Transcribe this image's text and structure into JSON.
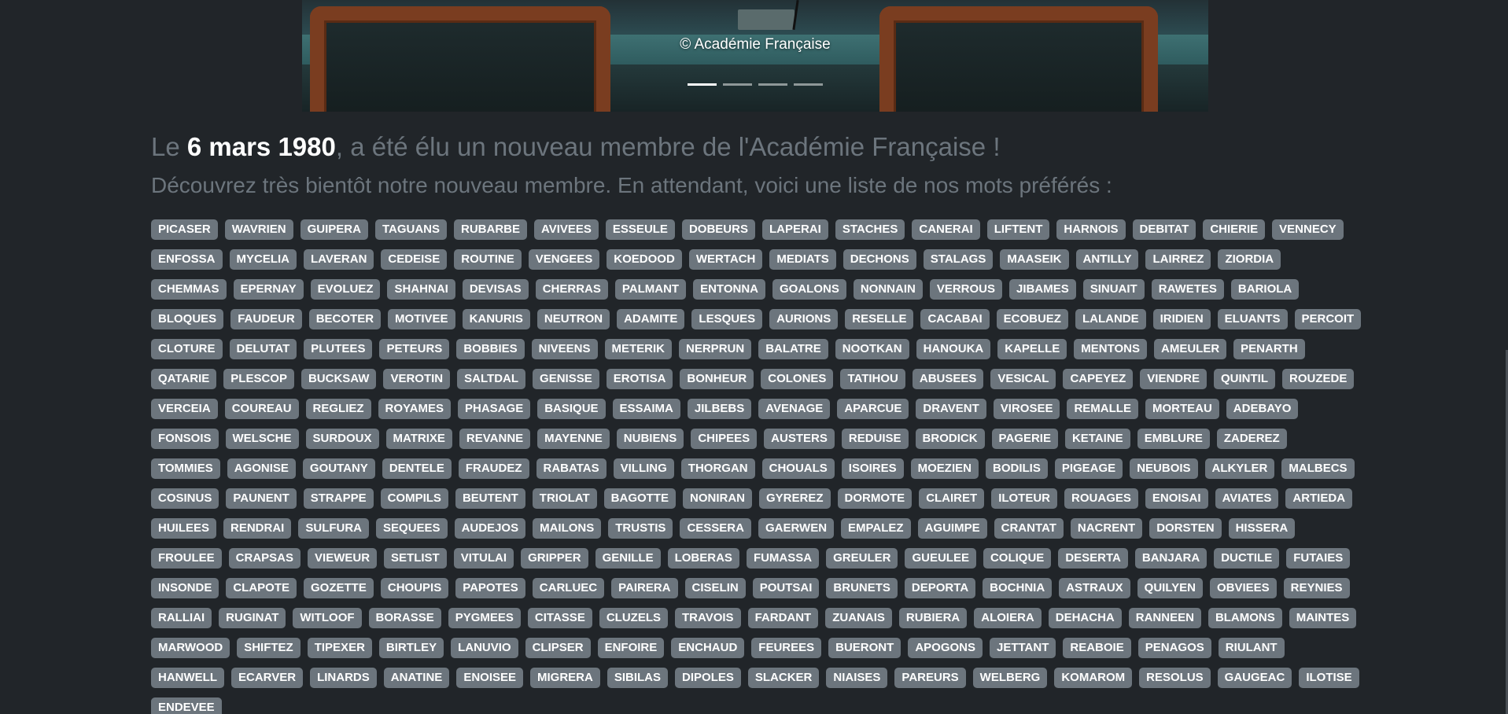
{
  "carousel": {
    "caption": "© Académie Française",
    "slide_count": 4,
    "active_index": 0
  },
  "headline": {
    "prefix": "Le ",
    "date": "6 mars 1980",
    "suffix": ", a été élu un nouveau membre de l'Académie Française !"
  },
  "subline": "Découvrez très bientôt notre nouveau membre. En attendant, voici une liste de nos mots préférés :",
  "badge_color": "#6c757d",
  "words": [
    "PICASER",
    "WAVRIEN",
    "GUIPERA",
    "TAGUANS",
    "RUBARBE",
    "AVIVEES",
    "ESSEULE",
    "DOBEURS",
    "LAPERAI",
    "STACHES",
    "CANERAI",
    "LIFTENT",
    "HARNOIS",
    "DEBITAT",
    "CHIERIE",
    "VENNECY",
    "ENFOSSA",
    "MYCELIA",
    "LAVERAN",
    "CEDEISE",
    "ROUTINE",
    "VENGEES",
    "KOEDOOD",
    "WERTACH",
    "MEDIATS",
    "DECHONS",
    "STALAGS",
    "MAASEIK",
    "ANTILLY",
    "LAIRREZ",
    "ZIORDIA",
    "CHEMMAS",
    "EPERNAY",
    "EVOLUEZ",
    "SHAHNAI",
    "DEVISAS",
    "CHERRAS",
    "PALMANT",
    "ENTONNA",
    "GOALONS",
    "NONNAIN",
    "VERROUS",
    "JIBAMES",
    "SINUAIT",
    "RAWETES",
    "BARIOLA",
    "BLOQUES",
    "FAUDEUR",
    "BECOTER",
    "MOTIVEE",
    "KANURIS",
    "NEUTRON",
    "ADAMITE",
    "LESQUES",
    "AURIONS",
    "RESELLE",
    "CACABAI",
    "ECOBUEZ",
    "LALANDE",
    "IRIDIEN",
    "ELUANTS",
    "PERCOIT",
    "CLOTURE",
    "DELUTAT",
    "PLUTEES",
    "PETEURS",
    "BOBBIES",
    "NIVEENS",
    "METERIK",
    "NERPRUN",
    "BALATRE",
    "NOOTKAN",
    "HANOUKA",
    "KAPELLE",
    "MENTONS",
    "AMEULER",
    "PENARTH",
    "QATARIE",
    "PLESCOP",
    "BUCKSAW",
    "VEROTIN",
    "SALTDAL",
    "GENISSE",
    "EROTISA",
    "BONHEUR",
    "COLONES",
    "TATIHOU",
    "ABUSEES",
    "VESICAL",
    "CAPEYEZ",
    "VIENDRE",
    "QUINTIL",
    "ROUZEDE",
    "VERCEIA",
    "COUREAU",
    "REGLIEZ",
    "ROYAMES",
    "PHASAGE",
    "BASIQUE",
    "ESSAIMA",
    "JILBEBS",
    "AVENAGE",
    "APARCUE",
    "DRAVENT",
    "VIROSEE",
    "REMALLE",
    "MORTEAU",
    "ADEBAYO",
    "FONSOIS",
    "WELSCHE",
    "SURDOUX",
    "MATRIXE",
    "REVANNE",
    "MAYENNE",
    "NUBIENS",
    "CHIPEES",
    "AUSTERS",
    "REDUISE",
    "BRODICK",
    "PAGERIE",
    "KETAINE",
    "EMBLURE",
    "ZADEREZ",
    "TOMMIES",
    "AGONISE",
    "GOUTANY",
    "DENTELE",
    "FRAUDEZ",
    "RABATAS",
    "VILLING",
    "THORGAN",
    "CHOUALS",
    "ISOIRES",
    "MOEZIEN",
    "BODILIS",
    "PIGEAGE",
    "NEUBOIS",
    "ALKYLER",
    "MALBECS",
    "COSINUS",
    "PAUNENT",
    "STRAPPE",
    "COMPILS",
    "BEUTENT",
    "TRIOLAT",
    "BAGOTTE",
    "NONIRAN",
    "GYREREZ",
    "DORMOTE",
    "CLAIRET",
    "ILOTEUR",
    "ROUAGES",
    "ENOISAI",
    "AVIATES",
    "ARTIEDA",
    "HUILEES",
    "RENDRAI",
    "SULFURA",
    "SEQUEES",
    "AUDEJOS",
    "MAILONS",
    "TRUSTIS",
    "CESSERA",
    "GAERWEN",
    "EMPALEZ",
    "AGUIMPE",
    "CRANTAT",
    "NACRENT",
    "DORSTEN",
    "HISSERA",
    "FROULEE",
    "CRAPSAS",
    "VIEWEUR",
    "SETLIST",
    "VITULAI",
    "GRIPPER",
    "GENILLE",
    "LOBERAS",
    "FUMASSA",
    "GREULER",
    "GUEULEE",
    "COLIQUE",
    "DESERTA",
    "BANJARA",
    "DUCTILE",
    "FUTAIES",
    "INSONDE",
    "CLAPOTE",
    "GOZETTE",
    "CHOUPIS",
    "PAPOTES",
    "CARLUEC",
    "PAIRERA",
    "CISELIN",
    "POUTSAI",
    "BRUNETS",
    "DEPORTA",
    "BOCHNIA",
    "ASTRAUX",
    "QUILYEN",
    "OBVIEES",
    "REYNIES",
    "RALLIAI",
    "RUGINAT",
    "WITLOOF",
    "BORASSE",
    "PYGMEES",
    "CITASSE",
    "CLUZELS",
    "TRAVOIS",
    "FARDANT",
    "ZUANAIS",
    "RUBIERA",
    "ALOIERA",
    "DEHACHA",
    "RANNEEN",
    "BLAMONS",
    "MAINTES",
    "MARWOOD",
    "SHIFTEZ",
    "TIPEXER",
    "BIRTLEY",
    "LANUVIO",
    "CLIPSER",
    "ENFOIRE",
    "ENCHAUD",
    "FEUREES",
    "BUERONT",
    "APOGONS",
    "JETTANT",
    "REABOIE",
    "PENAGOS",
    "RIULANT",
    "HANWELL",
    "ECARVER",
    "LINARDS",
    "ANATINE",
    "ENOISEE",
    "MIGRERA",
    "SIBILAS",
    "DIPOLES",
    "SLACKER",
    "NIAISES",
    "PAREURS",
    "WELBERG",
    "KOMAROM",
    "RESOLUS",
    "GAUGEAC",
    "ILOTISE",
    "ENDEVEE"
  ]
}
